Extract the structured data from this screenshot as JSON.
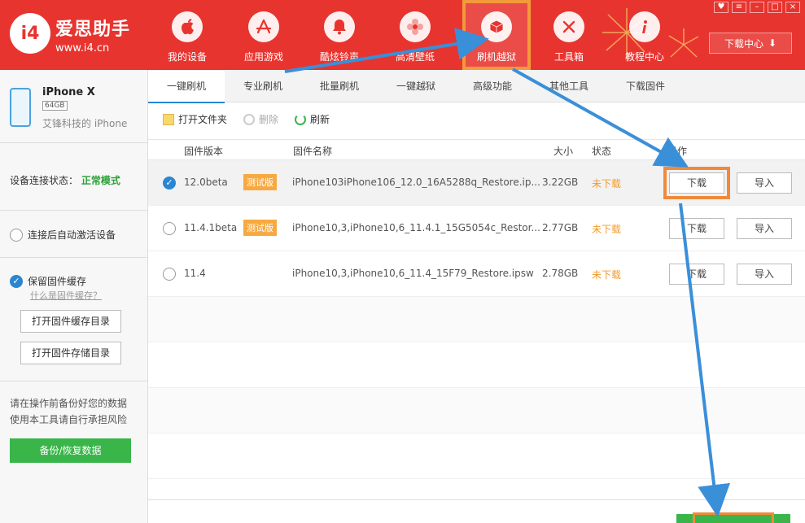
{
  "brand": {
    "name": "爱思助手",
    "url": "www.i4.cn",
    "logo": "i4"
  },
  "nav": [
    {
      "label": "我的设备",
      "icon": "apple-icon"
    },
    {
      "label": "应用游戏",
      "icon": "appstore-icon"
    },
    {
      "label": "酷炫铃声",
      "icon": "bell-icon"
    },
    {
      "label": "高清壁纸",
      "icon": "flower-icon"
    },
    {
      "label": "刷机越狱",
      "icon": "box-icon",
      "active": true
    },
    {
      "label": "工具箱",
      "icon": "tools-icon"
    },
    {
      "label": "教程中心",
      "icon": "info-icon"
    }
  ],
  "download_center": "下载中心",
  "device": {
    "name": "iPhone X",
    "capacity": "64GB",
    "owner": "艾锋科技的 iPhone"
  },
  "connection": {
    "label": "设备连接状态：",
    "value": "正常模式"
  },
  "options": {
    "auto_activate": "连接后自动激活设备",
    "keep_cache": "保留固件缓存",
    "what_is_cache": "什么是固件缓存？",
    "open_cache_dir": "打开固件缓存目录",
    "open_store_dir": "打开固件存储目录"
  },
  "warning": {
    "line1": "请在操作前备份好您的数据",
    "line2": "使用本工具请自行承担风险"
  },
  "backup_button": "备份/恢复数据",
  "tabs": [
    "一键刷机",
    "专业刷机",
    "批量刷机",
    "一键越狱",
    "高级功能",
    "其他工具",
    "下载固件"
  ],
  "toolbar": {
    "open_folder": "打开文件夹",
    "delete": "删除",
    "refresh": "刷新"
  },
  "columns": {
    "version": "固件版本",
    "name": "固件名称",
    "size": "大小",
    "status": "状态",
    "action": "操作"
  },
  "rows": [
    {
      "version": "12.0beta",
      "badge": "测试版",
      "name": "iPhone103iPhone106_12.0_16A5288q_Restore.ip...",
      "size": "3.22GB",
      "status": "未下载",
      "download": "下载",
      "import": "导入",
      "selected": true
    },
    {
      "version": "11.4.1beta",
      "badge": "测试版",
      "name": "iPhone10,3,iPhone10,6_11.4.1_15G5054c_Restor...",
      "size": "2.77GB",
      "status": "未下载",
      "download": "下载",
      "import": "导入",
      "selected": false
    },
    {
      "version": "11.4",
      "badge": "",
      "name": "iPhone10,3,iPhone10,6_11.4_15F79_Restore.ipsw",
      "size": "2.78GB",
      "status": "未下载",
      "download": "下载",
      "import": "导入",
      "selected": false
    }
  ],
  "colors": {
    "header": "#e8342f",
    "accent_blue": "#2a86d1",
    "green": "#3ab54a",
    "highlight": "#f08a3a",
    "status": "#f39a2b"
  }
}
